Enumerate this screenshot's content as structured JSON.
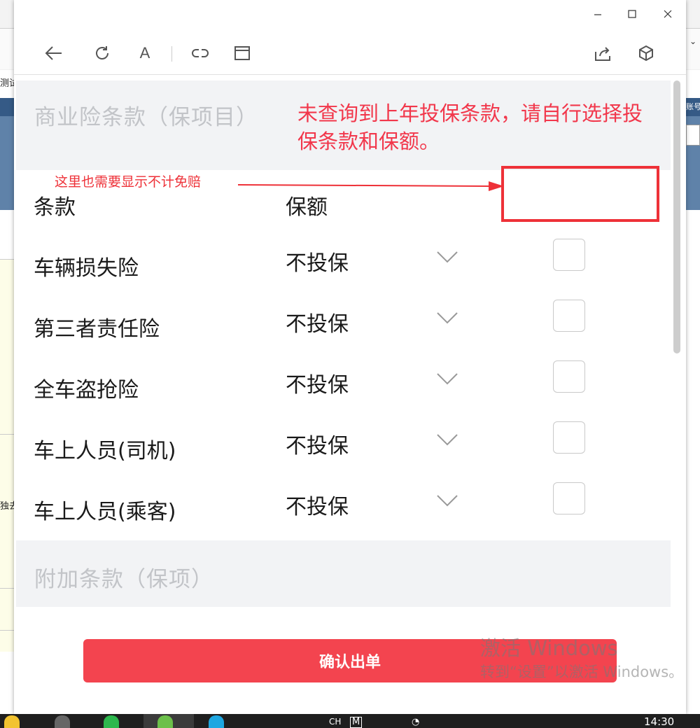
{
  "background": {
    "left_texts": [
      "测试",
      "独去"
    ],
    "right_text": "账号"
  },
  "toolbar": {
    "back": "back-arrow-icon",
    "refresh": "refresh-icon",
    "font": "A",
    "link": "link-icon",
    "window": "window-icon",
    "share": "share-icon",
    "cube": "cube-icon"
  },
  "commercial_section": {
    "title": "商业险条款（保项目）",
    "notice": "未查询到上年投保条款，请自行选择投保条款和保额。"
  },
  "annotation": {
    "text": "这里也需要显示不计免赔",
    "color": "#ee3138"
  },
  "table": {
    "col_clause": "条款",
    "col_amount": "保额",
    "rows": [
      {
        "name": "车辆损失险",
        "value": "不投保",
        "checked": false
      },
      {
        "name": "第三者责任险",
        "value": "不投保",
        "checked": false
      },
      {
        "name": "全车盗抢险",
        "value": "不投保",
        "checked": false
      },
      {
        "name": "车上人员(司机)",
        "value": "不投保",
        "checked": false
      },
      {
        "name": "车上人员(乘客)",
        "value": "不投保",
        "checked": false
      }
    ]
  },
  "addon_section": {
    "title": "附加条款（保项）"
  },
  "confirm_button": {
    "label": "确认出单",
    "color": "#f3444f"
  },
  "watermark": {
    "line1": "激活 Windows",
    "line2": "转到“设置”以激活 Windows。"
  },
  "taskbar": {
    "lang": "CH",
    "ime": "M",
    "time": "14:30"
  }
}
